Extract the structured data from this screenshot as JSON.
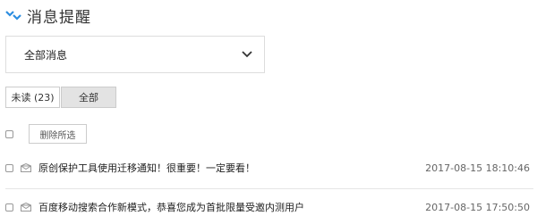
{
  "header": {
    "title": "消息提醒",
    "logo_icon": "chevron-logo-icon",
    "accent_color": "#2d8ee0"
  },
  "filter": {
    "selected": "全部消息"
  },
  "tabs": [
    {
      "label": "未读 (23)",
      "active": false
    },
    {
      "label": "全部",
      "active": true
    }
  ],
  "toolbar": {
    "delete_label": "删除所选"
  },
  "messages": [
    {
      "title": "原创保护工具使用迁移通知！很重要！一定要看！",
      "time": "2017-08-15 18:10:46"
    },
    {
      "title": "百度移动搜索合作新模式，恭喜您成为首批限量受邀内测用户",
      "time": "2017-08-15 17:50:50"
    }
  ]
}
